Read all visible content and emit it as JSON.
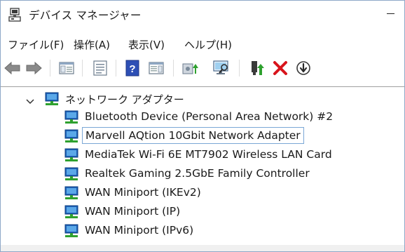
{
  "window": {
    "title": "デバイス マネージャー"
  },
  "menu": [
    {
      "label": "ファイル(F)"
    },
    {
      "label": "操作(A)"
    },
    {
      "label": "表示(V)"
    },
    {
      "label": "ヘルプ(H)"
    }
  ],
  "toolbar": {
    "buttons": [
      {
        "name": "back-arrow-icon"
      },
      {
        "name": "forward-arrow-icon"
      },
      {
        "name": "show-hide-console-tree-icon"
      },
      {
        "name": "properties-sheet-icon"
      },
      {
        "name": "help-icon"
      },
      {
        "name": "action-pane-icon"
      },
      {
        "name": "update-driver-icon"
      },
      {
        "name": "scan-hardware-icon"
      },
      {
        "name": "enable-device-icon"
      },
      {
        "name": "uninstall-device-icon"
      },
      {
        "name": "disable-device-icon"
      }
    ]
  },
  "tree": {
    "category": {
      "label": "ネットワーク アダプター",
      "expanded": true
    },
    "devices": [
      {
        "label": "Bluetooth Device (Personal Area Network) #2",
        "selected": false
      },
      {
        "label": "Marvell AQtion 10Gbit Network Adapter",
        "selected": true
      },
      {
        "label": "MediaTek Wi-Fi 6E MT7902 Wireless LAN Card",
        "selected": false
      },
      {
        "label": "Realtek Gaming 2.5GbE Family Controller",
        "selected": false
      },
      {
        "label": "WAN Miniport (IKEv2)",
        "selected": false
      },
      {
        "label": "WAN Miniport (IP)",
        "selected": false
      },
      {
        "label": "WAN Miniport (IPv6)",
        "selected": false
      }
    ]
  },
  "colors": {
    "accent_blue": "#1e62b8",
    "network_green": "#2fa12f",
    "selection_border": "#7aa7d6",
    "delete_red": "#d8141c"
  }
}
